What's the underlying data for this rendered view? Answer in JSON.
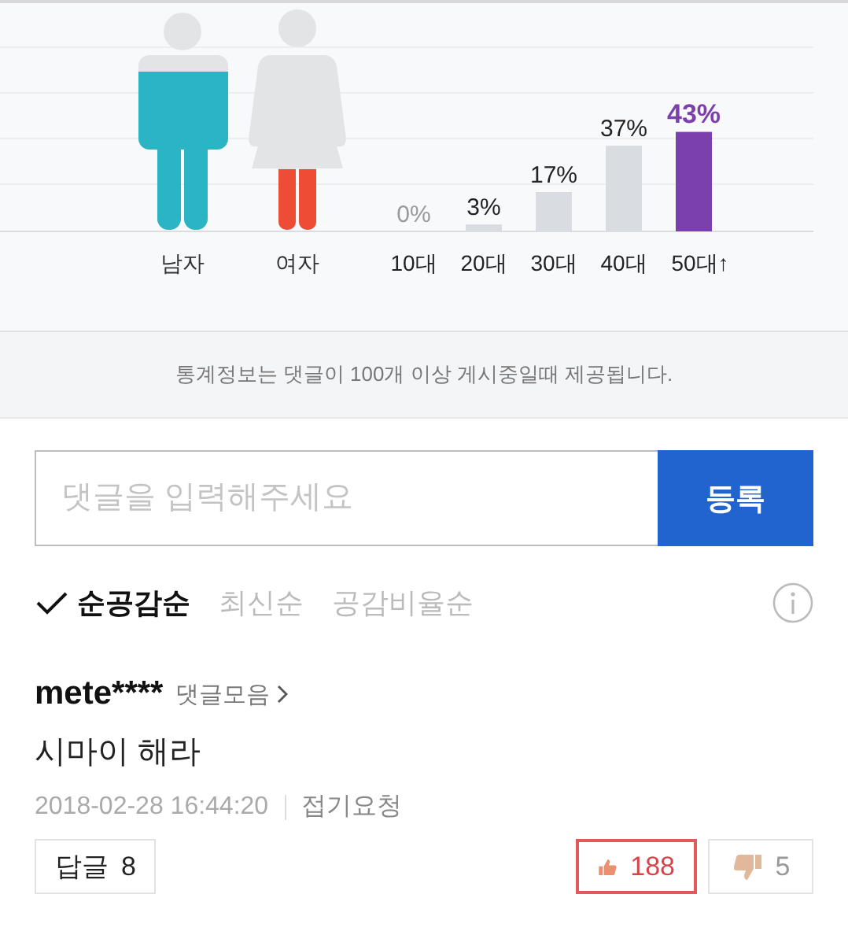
{
  "gender_stats": [
    {
      "label": "남자",
      "color": "#2bb5c4"
    },
    {
      "label": "여자",
      "color": "#ee4c35"
    }
  ],
  "age_stats": {
    "chart_data": {
      "type": "bar",
      "categories": [
        "10대",
        "20대",
        "30대",
        "40대",
        "50대↑"
      ],
      "values": [
        0,
        3,
        17,
        37,
        43
      ],
      "value_labels": [
        "0%",
        "3%",
        "17%",
        "37%",
        "43%"
      ]
    }
  },
  "notice": "통계정보는 댓글이 100개 이상 게시중일때 제공됩니다.",
  "comment_form": {
    "placeholder": "댓글을 입력해주세요",
    "submit": "등록"
  },
  "sort_options": [
    {
      "label": "순공감순",
      "selected": true
    },
    {
      "label": "최신순",
      "selected": false
    },
    {
      "label": "공감비율순",
      "selected": false
    }
  ],
  "comments": [
    {
      "author": "mete****",
      "author_link": "댓글모음",
      "text": "시마이 해라",
      "date": "2018-02-28 16:44:20",
      "report": "접기요청",
      "reply_label": "답글",
      "reply_count": "8",
      "likes": "188",
      "dislikes": "5",
      "liked": true
    }
  ]
}
